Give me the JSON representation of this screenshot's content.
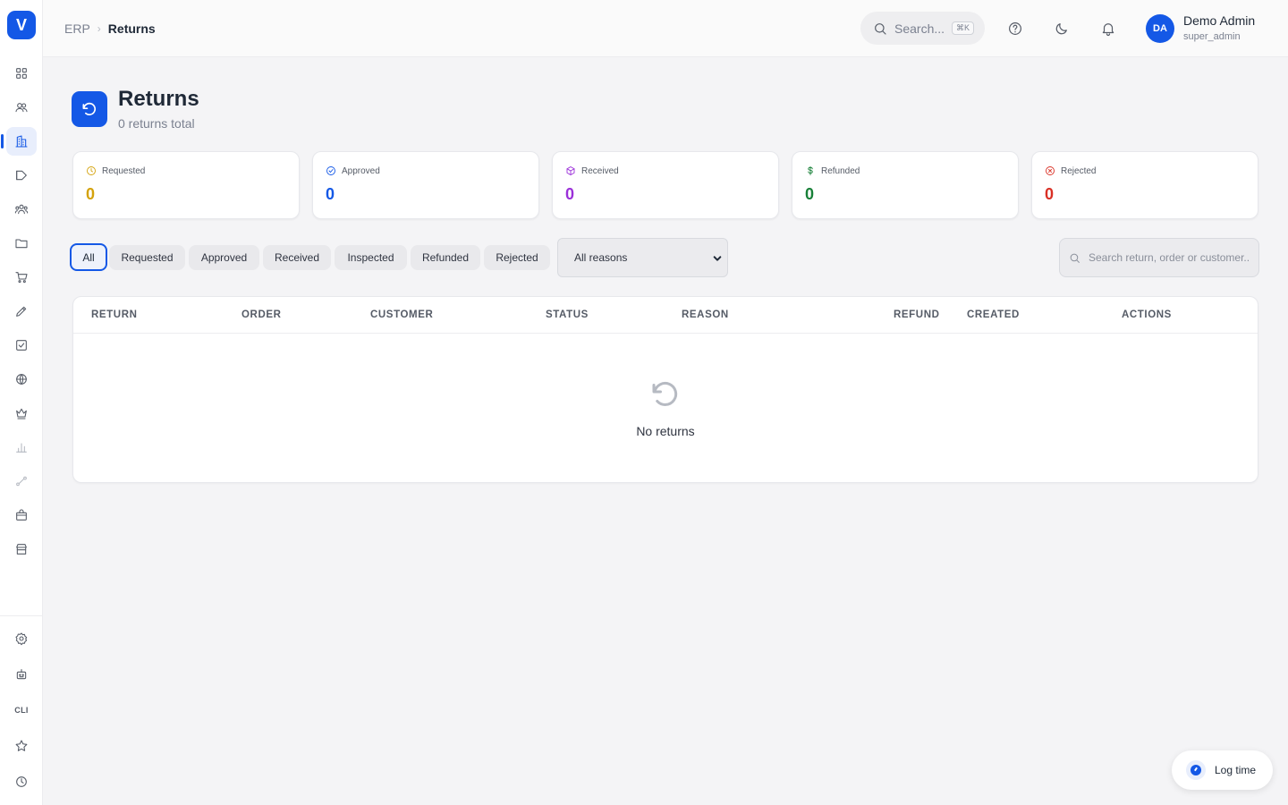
{
  "app": {
    "logo_letter": "V"
  },
  "sidebar": {
    "items": [
      {
        "name": "dashboard",
        "icon": "grid-icon"
      },
      {
        "name": "contacts",
        "icon": "users-icon"
      },
      {
        "name": "erp",
        "icon": "building-icon",
        "active": true
      },
      {
        "name": "marketing",
        "icon": "megaphone-icon"
      },
      {
        "name": "team",
        "icon": "team-icon"
      },
      {
        "name": "files",
        "icon": "folder-icon"
      },
      {
        "name": "commerce",
        "icon": "cart-icon"
      },
      {
        "name": "content",
        "icon": "pen-icon"
      },
      {
        "name": "tasks",
        "icon": "checkbox-icon"
      },
      {
        "name": "web",
        "icon": "globe-icon"
      },
      {
        "name": "membership",
        "icon": "crown-icon"
      },
      {
        "name": "analytics",
        "icon": "bar-chart-icon"
      },
      {
        "name": "workflows",
        "icon": "flow-icon"
      },
      {
        "name": "products",
        "icon": "shopping-bag-icon"
      },
      {
        "name": "store",
        "icon": "store-icon"
      }
    ],
    "bottom_items": [
      {
        "name": "settings",
        "icon": "gear-icon"
      },
      {
        "name": "ai",
        "icon": "robot-icon"
      },
      {
        "name": "cli",
        "label": "CLI"
      },
      {
        "name": "favorites",
        "icon": "star-icon"
      },
      {
        "name": "history",
        "icon": "clock-icon"
      }
    ]
  },
  "header": {
    "breadcrumb_root": "ERP",
    "breadcrumb_sep": "›",
    "breadcrumb_current": "Returns",
    "search_label": "Search...",
    "search_shortcut": "⌘K",
    "user_initials": "DA",
    "user_name": "Demo Admin",
    "user_role": "super_admin"
  },
  "page": {
    "title": "Returns",
    "subtitle": "0 returns total"
  },
  "stats": [
    {
      "label": "Requested",
      "value": "0",
      "color": "#d4a20c",
      "icon": "clock-icon"
    },
    {
      "label": "Approved",
      "value": "0",
      "color": "#1458e6",
      "icon": "check-circle-icon"
    },
    {
      "label": "Received",
      "value": "0",
      "color": "#9b30d9",
      "icon": "box-icon"
    },
    {
      "label": "Refunded",
      "value": "0",
      "color": "#188038",
      "icon": "dollar-icon"
    },
    {
      "label": "Rejected",
      "value": "0",
      "color": "#d93025",
      "icon": "x-circle-icon"
    }
  ],
  "filters": {
    "chips": [
      "All",
      "Requested",
      "Approved",
      "Received",
      "Inspected",
      "Refunded",
      "Rejected"
    ],
    "active": "All",
    "reason_selected": "All reasons",
    "search_placeholder": "Search return, order or customer..."
  },
  "table": {
    "columns": [
      "RETURN",
      "ORDER",
      "CUSTOMER",
      "STATUS",
      "REASON",
      "REFUND",
      "CREATED",
      "ACTIONS"
    ],
    "rows": [],
    "empty_text": "No returns"
  },
  "floating": {
    "log_time_label": "Log time"
  }
}
